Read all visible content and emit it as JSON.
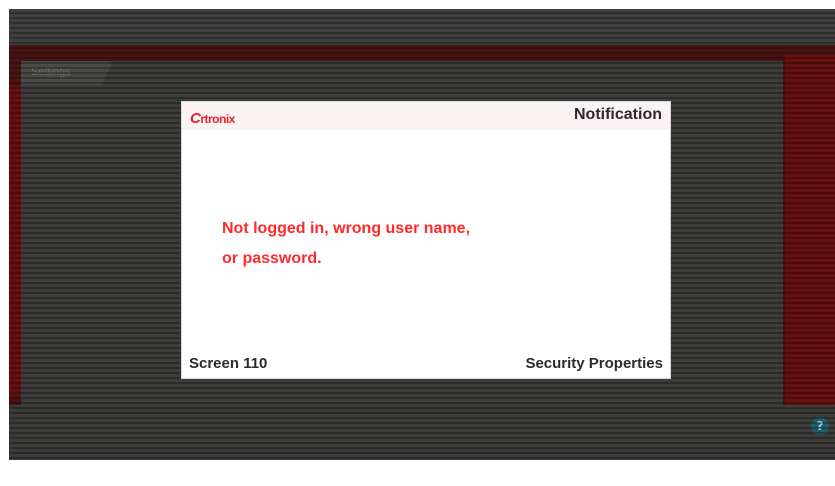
{
  "background": {
    "tab_label": "Settings",
    "help_label": "?"
  },
  "dialog": {
    "logo_initial": "C",
    "logo_rest": "rtronix",
    "title": "Notification",
    "message_line1": "Not logged in, wrong user name,",
    "message_line2": "or password.",
    "screen_label": "Screen 110",
    "footer_right": "Security Properties"
  },
  "colors": {
    "accent_red": "#ff2a2a",
    "brand_red": "#e1252d",
    "dialog_bg": "#ffffff",
    "dimmed_bg": "#3a3a38"
  }
}
